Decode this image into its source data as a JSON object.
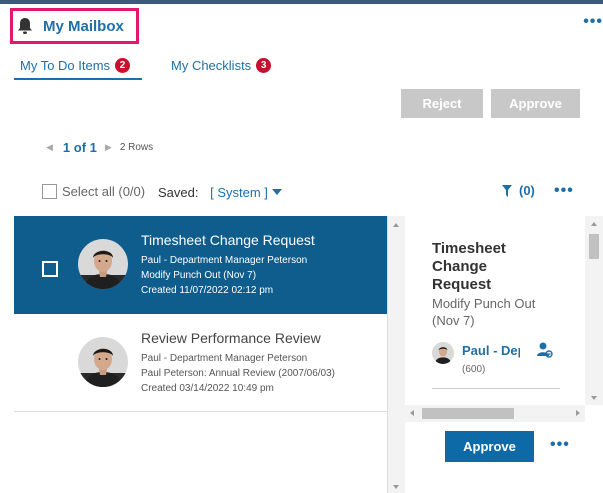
{
  "header": {
    "title": "My Mailbox",
    "more_label": "•••"
  },
  "tabs": [
    {
      "label": "My To Do Items",
      "count": "2"
    },
    {
      "label": "My Checklists",
      "count": "3"
    }
  ],
  "actions": {
    "reject": "Reject",
    "approve": "Approve"
  },
  "pager": {
    "page": "1 of 1",
    "rows": "2 Rows"
  },
  "toolbar": {
    "select_all": "Select all (0/0)",
    "saved_label": "Saved:",
    "saved_value": "[ System ]",
    "filter_count": "(0)",
    "more_label": "•••"
  },
  "items": [
    {
      "title": "Timesheet Change Request",
      "line1": "Paul - Department Manager Peterson",
      "line2": "Modify Punch Out (Nov 7)",
      "line3": "Created 11/07/2022 02:12 pm",
      "selected": true
    },
    {
      "title": "Review Performance Review",
      "line1": "Paul - Department Manager Peterson",
      "line2": "Paul Peterson: Annual Review (2007/06/03)",
      "line3": "Created 03/14/2022 10:49 pm",
      "selected": false
    }
  ],
  "detail": {
    "title": "Timesheet Change Request",
    "subtitle": "Modify Punch Out (Nov 7)",
    "person": "Paul - Department Manager Peterson",
    "person_id": "(600)",
    "approve": "Approve",
    "more_label": "•••"
  },
  "colors": {
    "accent": "#1f6fa6",
    "selected_row": "#0e5d8c",
    "highlight_border": "#e0196d",
    "badge": "#c8102e",
    "disabled_button": "#c8c8c8"
  },
  "icons": [
    "bell-icon",
    "filter-icon",
    "person-link-icon",
    "caret-down-icon"
  ]
}
